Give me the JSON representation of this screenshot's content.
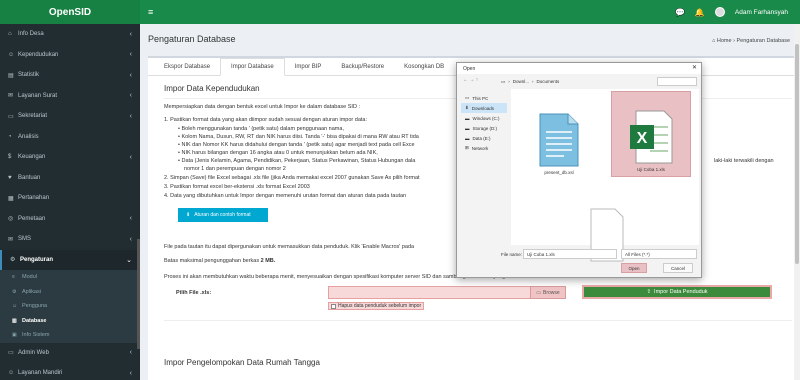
{
  "app": {
    "brand": "OpenSID"
  },
  "topbar": {
    "user_name": "Adam Farhansyah"
  },
  "sidebar": {
    "items": [
      {
        "label": "Info Desa",
        "icon": "home-icon"
      },
      {
        "label": "Kependudukan",
        "icon": "users-icon"
      },
      {
        "label": "Statistik",
        "icon": "chart-icon"
      },
      {
        "label": "Layanan Surat",
        "icon": "envelope-icon"
      },
      {
        "label": "Sekretariat",
        "icon": "folder-icon"
      },
      {
        "label": "Analisis",
        "icon": "analysis-icon"
      },
      {
        "label": "Keuangan",
        "icon": "money-icon"
      },
      {
        "label": "Bantuan",
        "icon": "heart-icon"
      },
      {
        "label": "Pertanahan",
        "icon": "map-icon"
      },
      {
        "label": "Pemetaan",
        "icon": "globe-icon"
      },
      {
        "label": "SMS",
        "icon": "sms-icon"
      },
      {
        "label": "Pengaturan",
        "icon": "gear-icon"
      }
    ],
    "sub_items": [
      {
        "label": "Modul"
      },
      {
        "label": "Aplikasi"
      },
      {
        "label": "Pengguna"
      },
      {
        "label": "Database"
      },
      {
        "label": "Info Sistem"
      }
    ],
    "bottom_items": [
      {
        "label": "Admin Web",
        "icon": "desktop-icon"
      },
      {
        "label": "Layanan Mandiri",
        "icon": "person-icon"
      }
    ]
  },
  "header": {
    "title": "Pengaturan Database",
    "breadcrumb_home": "Home",
    "breadcrumb_current": "Pengaturan Database"
  },
  "tabs": [
    "Ekspor Database",
    "Impor Database",
    "Impor BIP",
    "Backup/Restore",
    "Kosongkan DB"
  ],
  "main": {
    "section1_title": "Impor Data Kependudukan",
    "intro": "Mempersiapkan data dengan bentuk excel untuk Impor ke dalam database SID :",
    "step1": "1. Pastikan format data yang akan diimpor sudah sesuai dengan aturan impor data:",
    "bullets": [
      "Boleh menggunakan tanda ' (petik satu) dalam penggunaan nama,",
      "Kolom Nama, Dusun, RW, RT dan NIK harus diisi. Tanda '-' bisa dipakai di mana RW atau RT tida",
      "NIK dan Nomor KK harus didahului dengan tanda ' (petik satu) agar menjadi text pada cell Exce",
      "NIK harus bilangan dengan 16 angka atau 0 untuk menunjukkan belum ada NIK,",
      "Data (Jenis Kelamin, Agama, Pendidikan, Pekerjaan, Status Perkawinan, Status Hubungan dala"
    ],
    "bullet5_tail": "laki-laki terwakili dengan",
    "bullet5_line2": "nomor 1 dan perempuan dengan nomor 2",
    "step2": "2. Simpan (Save) file Excel sebagai .xls file (jika Anda memakai excel 2007 gunakan Save As pilih format",
    "step3": "3. Pastikan format excel ber-ekstensi .xls format Excel 2003",
    "step4": "4. Data yang dibutuhkan untuk Impor dengan memenuhi urutan format dan aturan data pada tautan",
    "download_button": "Aturan dan contoh format",
    "macro_text": "File pada tautan itu dapat dipergunakan untuk memasukkan data penduduk. Klik 'Enable Macros' pada",
    "max_label": "Batas maksimal pengunggahan berkas",
    "max_value": "2 MB.",
    "process_text": "Proses ini akan membutuhkan waktu beberapa menit, menyesuaikan dengan spesifikasi komputer server SID dan sambungan internet yang tersedia.",
    "file_label": "Pilih File .xls:",
    "browse_button": "Browse",
    "import_button": "Impor Data Penduduk",
    "checkbox_label": "Hapus data penduduk sebelum impor",
    "section2_title": "Impor Pengelompokan Data Rumah Tangga"
  },
  "dialog": {
    "title": "Open",
    "address": [
      "Downl...",
      "Documents"
    ],
    "sidebar": [
      "This PC",
      "Downloads",
      "Windows (C:)",
      "Storage (D:)",
      "Data (E:)",
      "Network"
    ],
    "files": [
      {
        "name": "present_db.xsl",
        "icon": "document-icon"
      },
      {
        "name": "Uji Coba 1.xls",
        "icon": "excel-icon"
      },
      {
        "name": "",
        "icon": "blank-file-icon"
      }
    ],
    "file_name_label": "File name:",
    "file_name_value": "Uji Coba 1.xls",
    "file_type": "All Files (*.*)",
    "open_button": "Open",
    "cancel_button": "Cancel"
  },
  "colors": {
    "topbar": "#1a8a4a",
    "sidebar": "#222d32",
    "info_button": "#00a7d0",
    "import_button": "#3c8b3c",
    "highlight": "#e9c1c4"
  }
}
